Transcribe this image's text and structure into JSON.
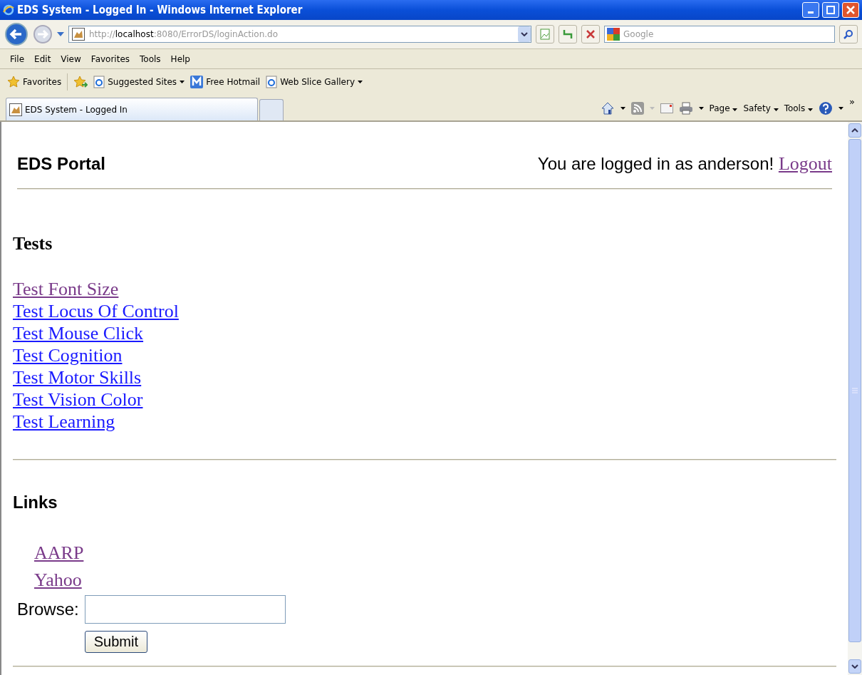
{
  "window": {
    "title": "EDS System - Logged In - Windows Internet Explorer"
  },
  "address_bar": {
    "url": "http://**localhost**:8080/ErrorDS/loginAction.do"
  },
  "search": {
    "placeholder": "Google"
  },
  "menu": [
    "File",
    "Edit",
    "View",
    "Favorites",
    "Tools",
    "Help"
  ],
  "favorites_bar": {
    "label": "Favorites",
    "items": [
      {
        "label": "Suggested Sites",
        "kind": "ie",
        "dropdown": true
      },
      {
        "label": "Free Hotmail",
        "kind": "hotmail",
        "dropdown": false
      },
      {
        "label": "Web Slice Gallery",
        "kind": "ie",
        "dropdown": true
      }
    ]
  },
  "tabs": [
    {
      "label": "EDS System - Logged In",
      "selected": true
    }
  ],
  "command_bar": {
    "menus": [
      "Page",
      "Safety",
      "Tools"
    ],
    "overflow": "»"
  },
  "page": {
    "brand": "EDS Portal",
    "greeting": "You are logged in as anderson!",
    "logout": {
      "label": "Logout",
      "visited": true
    },
    "tests": {
      "heading": "Tests",
      "links": [
        {
          "label": "Test Font Size",
          "visited": true
        },
        {
          "label": "Test Locus Of Control",
          "visited": false
        },
        {
          "label": "Test Mouse Click",
          "visited": false
        },
        {
          "label": "Test Cognition",
          "visited": false
        },
        {
          "label": "Test Motor Skills",
          "visited": false
        },
        {
          "label": "Test Vision Color",
          "visited": false
        },
        {
          "label": "Test Learning",
          "visited": false
        }
      ]
    },
    "links": {
      "heading": "Links",
      "items": [
        {
          "label": "AARP",
          "visited": true
        },
        {
          "label": "Yahoo",
          "visited": true
        }
      ]
    },
    "browse": {
      "label": "Browse:",
      "button": "Submit"
    }
  }
}
